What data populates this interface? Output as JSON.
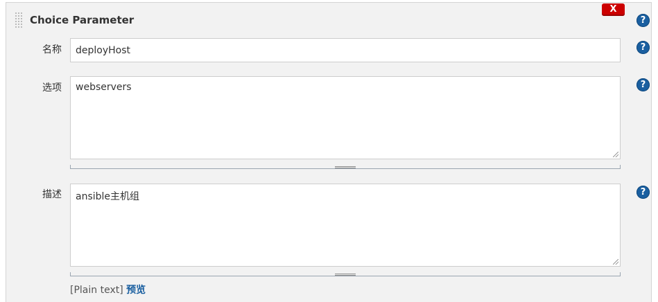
{
  "block": {
    "title": "Choice Parameter",
    "delete_label": "X"
  },
  "help_label": "?",
  "fields": {
    "name": {
      "label": "名称",
      "value": "deployHost"
    },
    "choices": {
      "label": "选项",
      "value": "webservers"
    },
    "description": {
      "label": "描述",
      "value": "ansible主机组"
    }
  },
  "footer": {
    "format": "[Plain text]",
    "preview_link": "预览"
  },
  "colors": {
    "delete_button": "#cc0000",
    "help_icon": "#1a5fa0",
    "link": "#1a5fa0",
    "panel_background": "#f2f2f2"
  }
}
